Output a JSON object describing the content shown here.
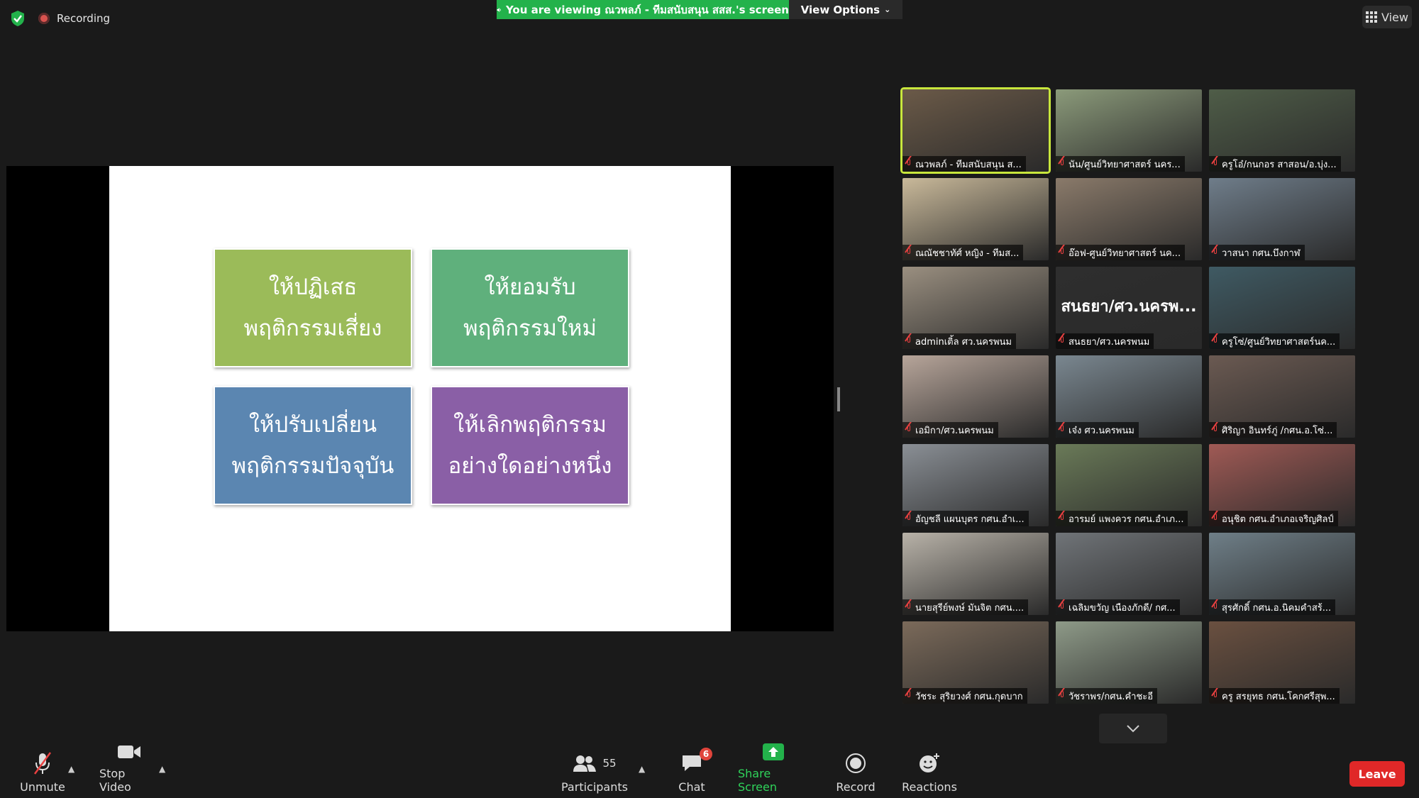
{
  "top_bar": {
    "recording_label": "Recording",
    "banner_text": "You are viewing ณวพลภ์ - ทีมสนับสนุน สสส.'s screen",
    "view_options_label": "View Options",
    "view_label": "View"
  },
  "slide": {
    "cards": [
      {
        "line1": "ให้ปฏิเสธ",
        "line2": "พฤติกรรมเสี่ยง"
      },
      {
        "line1": "ให้ยอมรับ",
        "line2": "พฤติกรรมใหม่"
      },
      {
        "line1": "ให้ปรับเปลี่ยน",
        "line2": "พฤติกรรมปัจจุบัน"
      },
      {
        "line1": "ให้เลิกพฤติกรรม",
        "line2": "อย่างใดอย่างหนึ่ง"
      }
    ]
  },
  "gallery": {
    "participants": [
      {
        "name": "ณวพลภ์ - ทีมสนับสนุน ส...",
        "active": true
      },
      {
        "name": "นัน/ศูนย์วิทยาศาสตร์ นคร..."
      },
      {
        "name": "ครูโอ๋/กนกอร สาสอน/อ.บุ่ง..."
      },
      {
        "name": "ณณัชชาทัศ์ หญิง - ทีมส..."
      },
      {
        "name": "อ๊อฟ-ศูนย์วิทยาศาสตร์ นค..."
      },
      {
        "name": "วาสนา กศน.บึงกาฬ"
      },
      {
        "name": "adminเติ้ล ศว.นครพนม"
      },
      {
        "name": "สนธยา/ศว.นครพนม",
        "display_name": "สนธยา/ศว.นครพ..."
      },
      {
        "name": "ครูโซ่/ศูนย์วิทยาศาสตร์นค..."
      },
      {
        "name": "เอมิกา/ศว.นครพนม"
      },
      {
        "name": "เจ๋ง ศว.นครพนม"
      },
      {
        "name": "ศิริญา อินทร์ภู่ /กศน.อ.โซ่..."
      },
      {
        "name": "อัญชลี แผนบุตร กศน.อำเ..."
      },
      {
        "name": "อารมย์ แพงควร กศน.อำเภ..."
      },
      {
        "name": "อนุชิต กศน.อำเภอเจริญศิลป์"
      },
      {
        "name": "นายสุรีย์พงษ์ มันจิต กศน...."
      },
      {
        "name": "เฉลิมขวัญ เนืองภักดี/ กศ..."
      },
      {
        "name": "สุรศักดิ์ กศน.อ.นิคมคำสร้..."
      },
      {
        "name": "วัชระ สุริยวงศ์ กศน.กุดบาก"
      },
      {
        "name": "วัชราพร/กศน.คำชะอี"
      },
      {
        "name": "ครู สรยุทธ กศน.โคกศรีสุพ..."
      }
    ]
  },
  "toolbar": {
    "unmute_label": "Unmute",
    "stop_video_label": "Stop Video",
    "participants_label": "Participants",
    "participants_count": "55",
    "chat_label": "Chat",
    "chat_badge": "6",
    "share_screen_label": "Share Screen",
    "record_label": "Record",
    "reactions_label": "Reactions",
    "leave_label": "Leave"
  },
  "colors": {
    "banner": "#23b24b",
    "card1": "#9bbb59",
    "card2": "#5fb07c",
    "card3": "#5b86b1",
    "card4": "#8a5fa6",
    "leave": "#e02828",
    "active_speaker": "#c8e63c"
  }
}
